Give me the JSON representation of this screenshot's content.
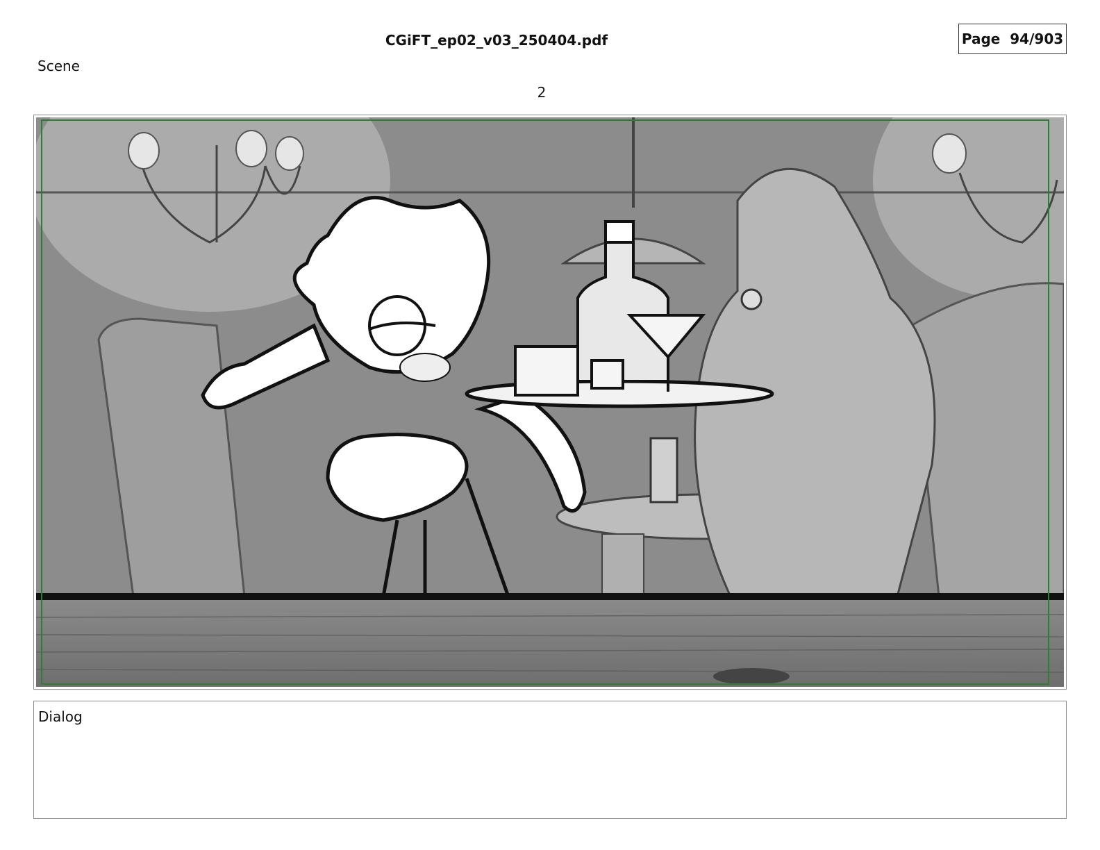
{
  "header": {
    "file_name": "CGiFT_ep02_v03_250404.pdf",
    "page_label": "Page",
    "page_number": "94/903"
  },
  "scene": {
    "label": "Scene",
    "number": "2"
  },
  "panel": {
    "image_kind": "storyboard-sketch",
    "safe_frame_color": "#2e7d32"
  },
  "dialog": {
    "label": "Dialog",
    "text": ""
  }
}
